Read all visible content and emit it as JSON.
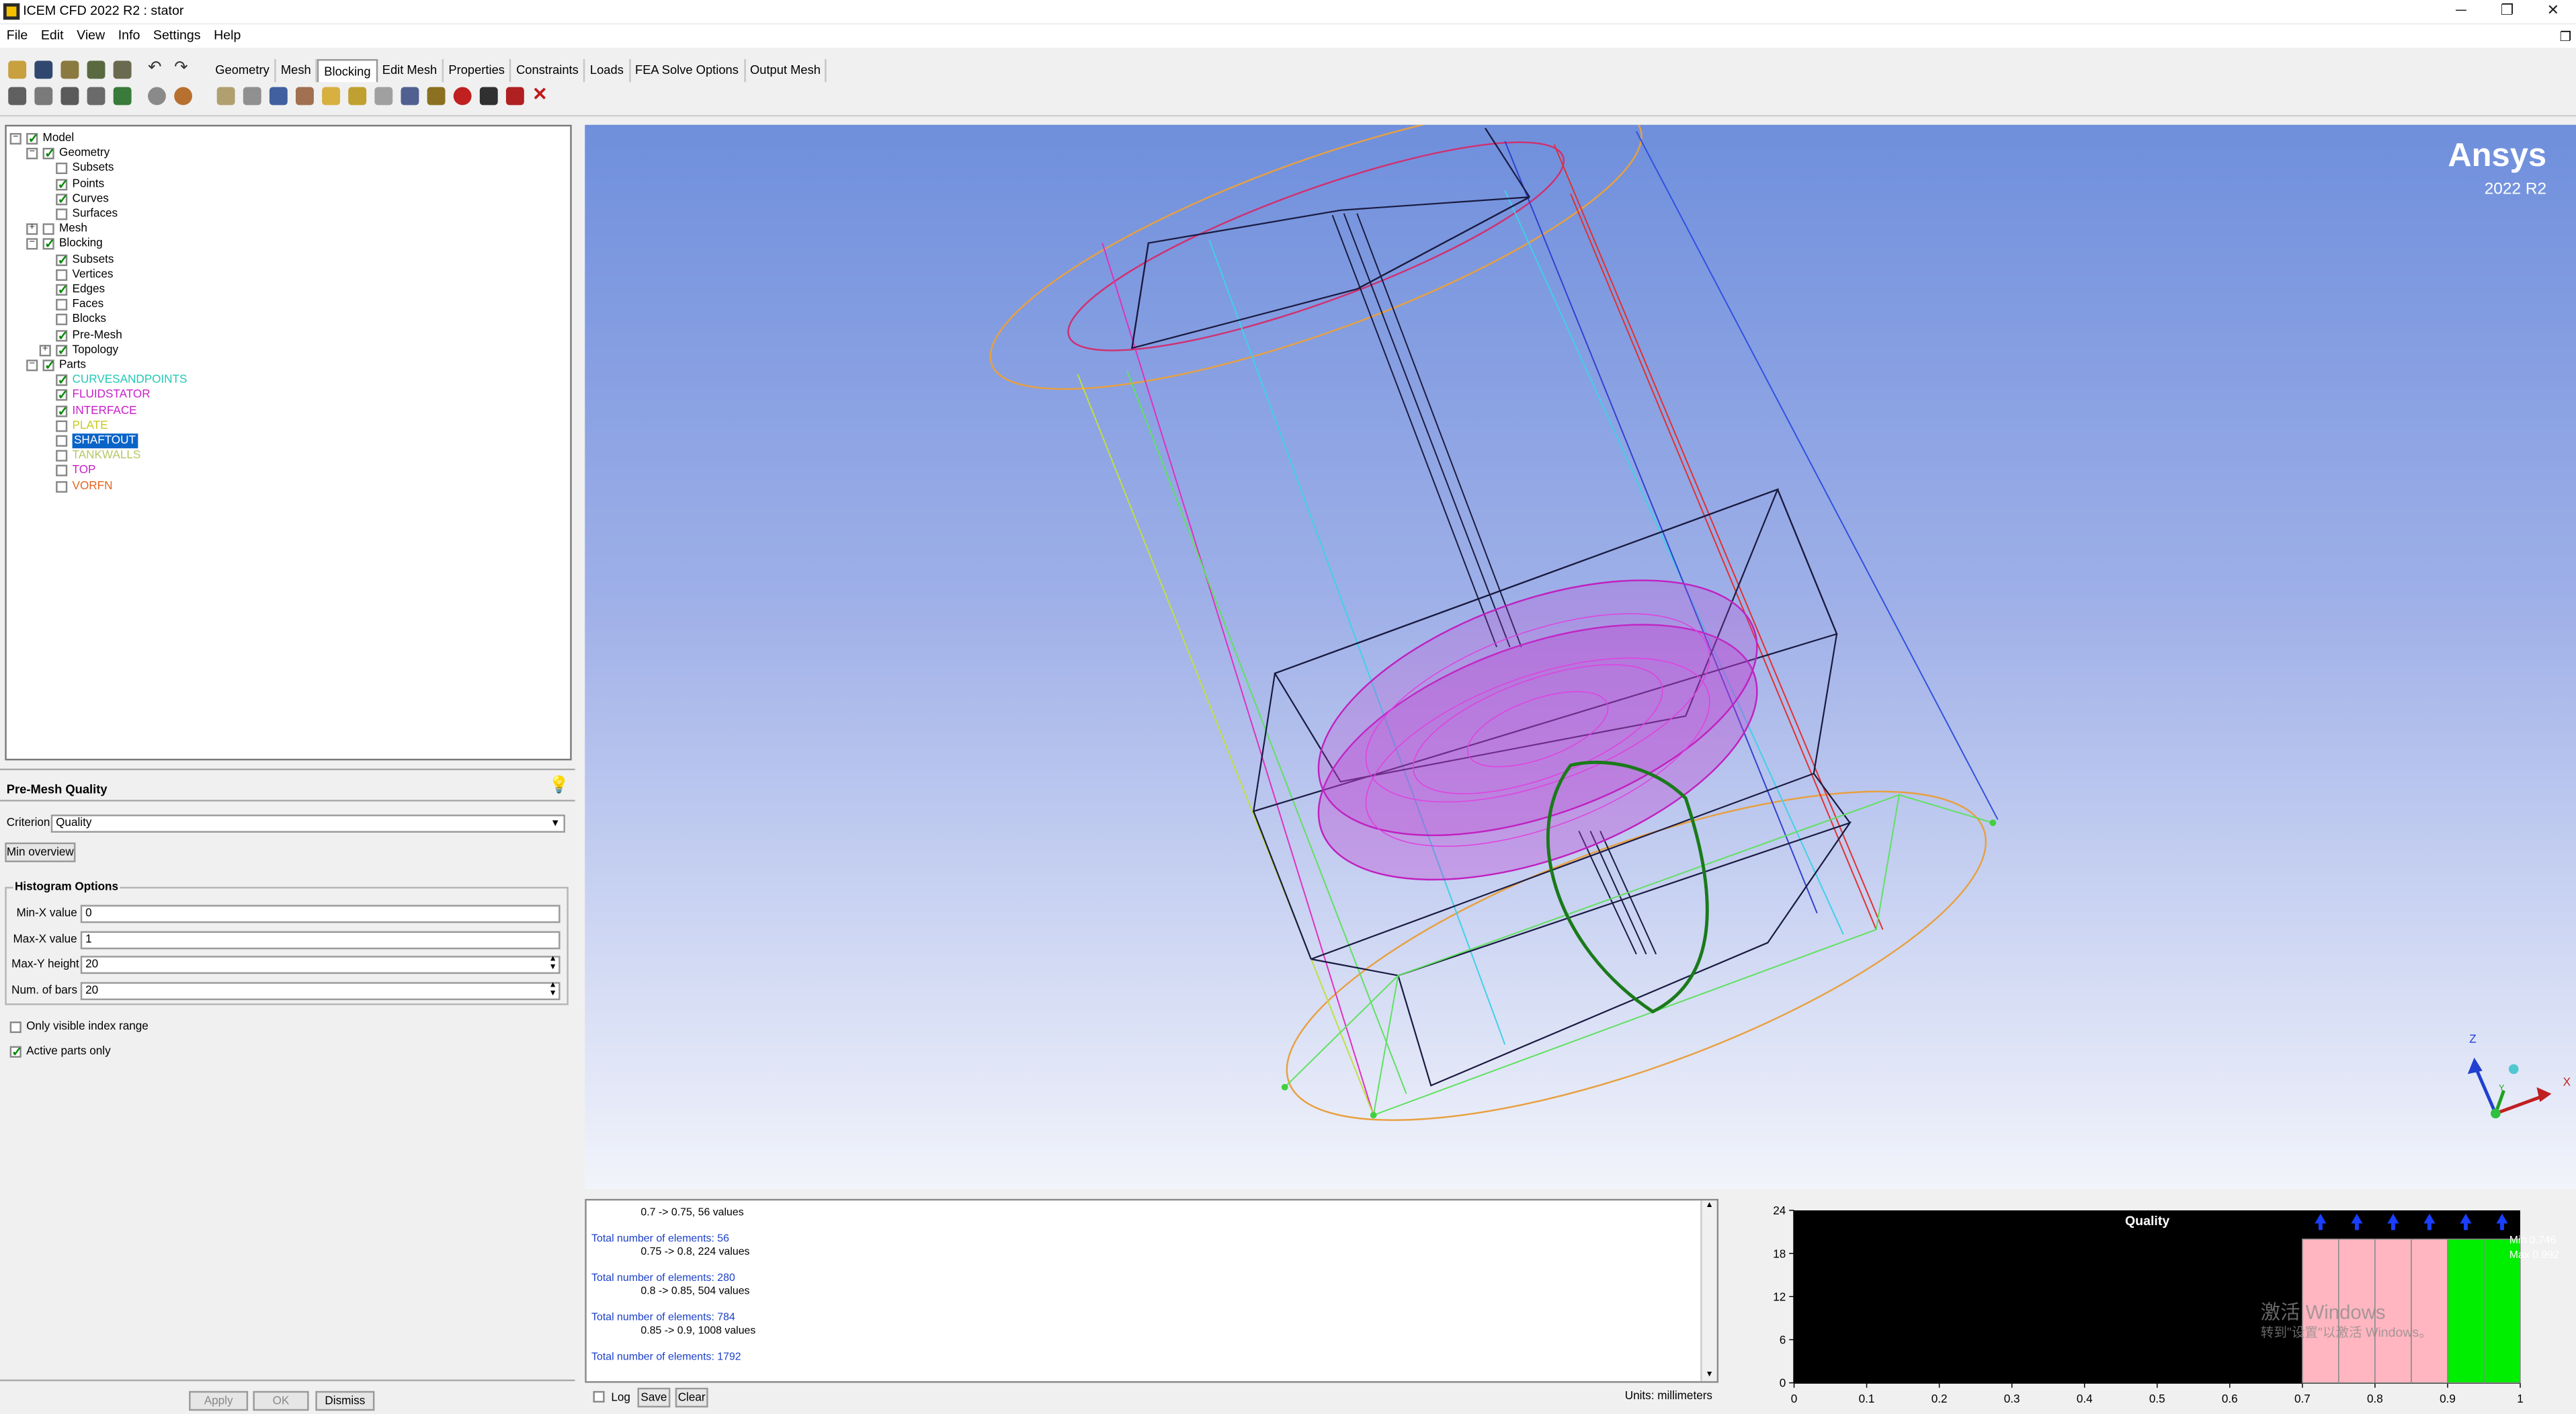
{
  "window": {
    "title": "ICEM CFD 2022 R2 : stator",
    "controls": [
      "─",
      "❐",
      "✕"
    ]
  },
  "menu": [
    "File",
    "Edit",
    "View",
    "Info",
    "Settings",
    "Help"
  ],
  "tabs": [
    "Geometry",
    "Mesh",
    "Blocking",
    "Edit Mesh",
    "Properties",
    "Constraints",
    "Loads",
    "FEA Solve Options",
    "Output Mesh"
  ],
  "active_tab": "Blocking",
  "tree": {
    "model": "Model",
    "geometry": "Geometry",
    "geometry_children": [
      {
        "label": "Subsets",
        "checked": false
      },
      {
        "label": "Points",
        "checked": true
      },
      {
        "label": "Curves",
        "checked": true
      },
      {
        "label": "Surfaces",
        "checked": false
      }
    ],
    "mesh": "Mesh",
    "blocking": "Blocking",
    "blocking_children": [
      {
        "label": "Subsets",
        "checked": true
      },
      {
        "label": "Vertices",
        "checked": false
      },
      {
        "label": "Edges",
        "checked": true
      },
      {
        "label": "Faces",
        "checked": false
      },
      {
        "label": "Blocks",
        "checked": false
      },
      {
        "label": "Pre-Mesh",
        "checked": true
      },
      {
        "label": "Topology",
        "checked": true
      }
    ],
    "parts": "Parts",
    "parts_children": [
      {
        "label": "CURVESANDPOINTS",
        "checked": true,
        "color": "#22c8b4"
      },
      {
        "label": "FLUIDSTATOR",
        "checked": true,
        "color": "#c81ec8"
      },
      {
        "label": "INTERFACE",
        "checked": true,
        "color": "#c81ec8"
      },
      {
        "label": "PLATE",
        "checked": false,
        "color": "#c8c81e"
      },
      {
        "label": "SHAFTOUT",
        "checked": false,
        "color": "#ffffff",
        "selected": true
      },
      {
        "label": "TANKWALLS",
        "checked": false,
        "color": "#b4c864"
      },
      {
        "label": "TOP",
        "checked": false,
        "color": "#c81ec8"
      },
      {
        "label": "VORFN",
        "checked": false,
        "color": "#e6641e"
      }
    ]
  },
  "premesh": {
    "title": "Pre-Mesh Quality",
    "criterion_label": "Criterion",
    "criterion_value": "Quality",
    "min_overview": "Min overview",
    "histogram_options": "Histogram Options",
    "min_x_label": "Min-X value",
    "min_x": "0",
    "max_x_label": "Max-X value",
    "max_x": "1",
    "max_y_label": "Max-Y height",
    "max_y": "20",
    "num_bars_label": "Num. of bars",
    "num_bars": "20",
    "visible_index": "Only visible index range",
    "visible_index_checked": false,
    "active_parts": "Active parts only",
    "active_parts_checked": true,
    "apply": "Apply",
    "ok": "OK",
    "dismiss": "Dismiss"
  },
  "viewport": {
    "brand": "Ansys",
    "version": "2022 R2",
    "axis_z": "Z",
    "axis_x": "X",
    "axis_y": "Y"
  },
  "messages": [
    {
      "text": "0.7 -> 0.75, 56 values",
      "blue": false
    },
    {
      "text": "Total number of elements: 56",
      "blue": true
    },
    {
      "text": "0.75 -> 0.8, 224 values",
      "blue": false
    },
    {
      "text": "Total number of elements: 280",
      "blue": true
    },
    {
      "text": "0.8 -> 0.85, 504 values",
      "blue": false
    },
    {
      "text": "Total number of elements: 784",
      "blue": true
    },
    {
      "text": "0.85 -> 0.9, 1008 values",
      "blue": false
    },
    {
      "text": "Total number of elements: 1792",
      "blue": true
    }
  ],
  "bottom": {
    "log": "Log",
    "save": "Save",
    "clear": "Clear",
    "units": "Units: millimeters"
  },
  "watermark": {
    "line1": "激活 Windows",
    "line2": "转到\"设置\"以激活 Windows。"
  },
  "chart_data": {
    "type": "bar",
    "title": "Quality",
    "xlim": [
      0,
      1
    ],
    "ylim": [
      0,
      24
    ],
    "x_ticks": [
      "0",
      "0.1",
      "0.2",
      "0.3",
      "0.4",
      "0.5",
      "0.6",
      "0.7",
      "0.8",
      "0.9",
      "1"
    ],
    "y_ticks": [
      "0",
      "6",
      "12",
      "18",
      "24"
    ],
    "bars": [
      {
        "x0": 0.7,
        "x1": 0.75,
        "value": 20,
        "color": "#ffb6c1"
      },
      {
        "x0": 0.75,
        "x1": 0.8,
        "value": 20,
        "color": "#ffb6c1"
      },
      {
        "x0": 0.8,
        "x1": 0.85,
        "value": 20,
        "color": "#ffb6c1"
      },
      {
        "x0": 0.85,
        "x1": 0.9,
        "value": 20,
        "color": "#ffb6c1"
      },
      {
        "x0": 0.9,
        "x1": 0.95,
        "value": 20,
        "color": "#00ee00"
      },
      {
        "x0": 0.95,
        "x1": 1.0,
        "value": 20,
        "color": "#00ee00"
      }
    ],
    "overflow_arrows": [
      0.725,
      0.775,
      0.825,
      0.875,
      0.925,
      0.975
    ],
    "min_label": "Min 0.746",
    "max_label": "Max 0.992"
  }
}
